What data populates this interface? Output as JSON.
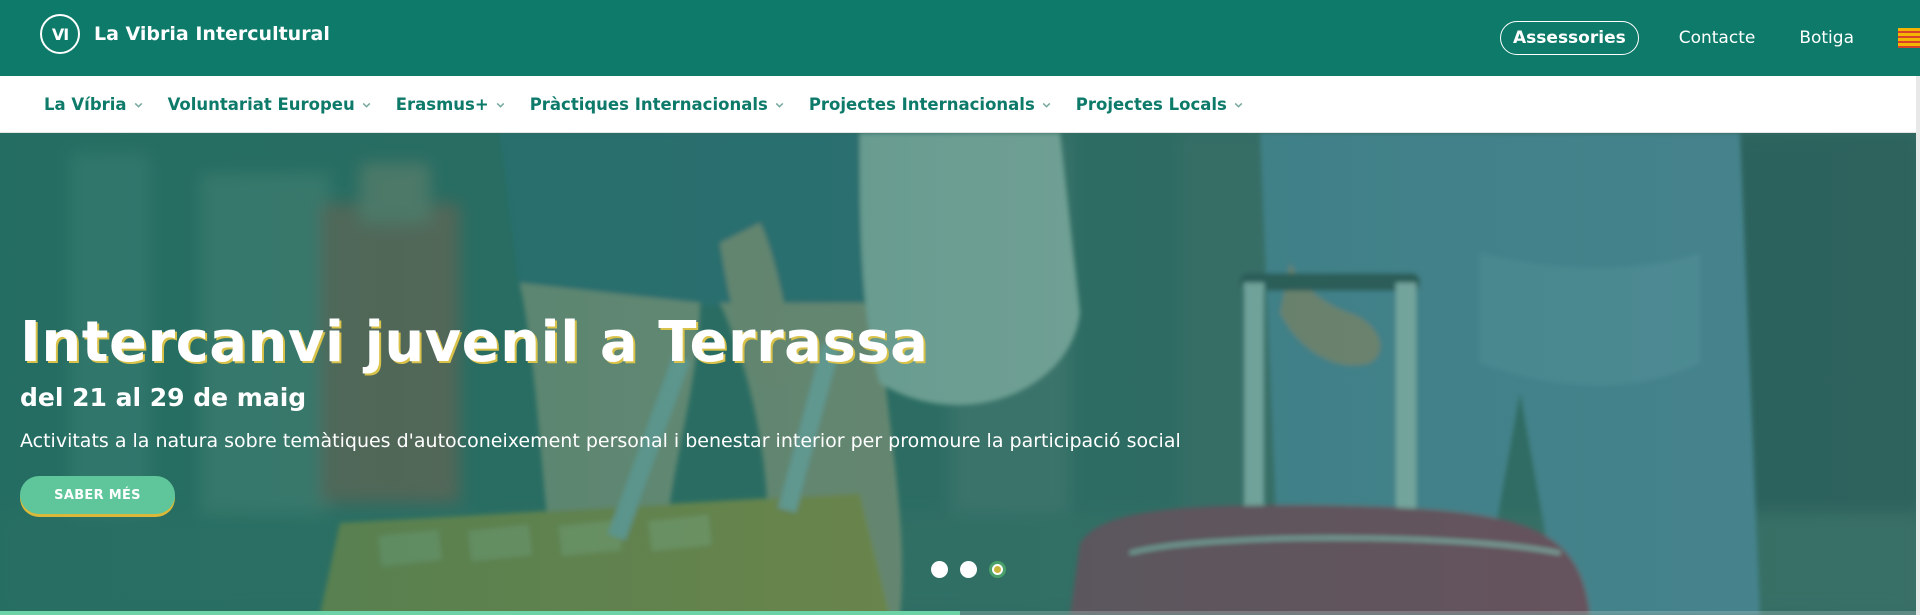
{
  "header": {
    "brand_name": "La Vibria Intercultural",
    "logo_letters": "VI",
    "assessories_label": "Assessories",
    "contact_label": "Contacte",
    "shop_label": "Botiga",
    "language_icon": "catalan-flag-icon"
  },
  "nav": {
    "items": [
      {
        "label": "La Víbria"
      },
      {
        "label": "Voluntariat Europeu"
      },
      {
        "label": "Erasmus+"
      },
      {
        "label": "Pràctiques Internacionals"
      },
      {
        "label": "Projectes Internacionals"
      },
      {
        "label": "Projectes Locals"
      }
    ]
  },
  "hero": {
    "title": "Intercanvi juvenil a Terrassa",
    "date": "del 21 al 29 de maig",
    "description": "Activitats a la natura sobre temàtiques d'autoconeixement personal i benestar interior per promoure la participació social",
    "cta_label": "SABER MÉS",
    "slides_total": 3,
    "active_slide": 3,
    "progress": 0.5
  },
  "colors": {
    "primary": "#0d7a6a",
    "accent": "#5ec69a",
    "highlight": "#d9c24a"
  }
}
